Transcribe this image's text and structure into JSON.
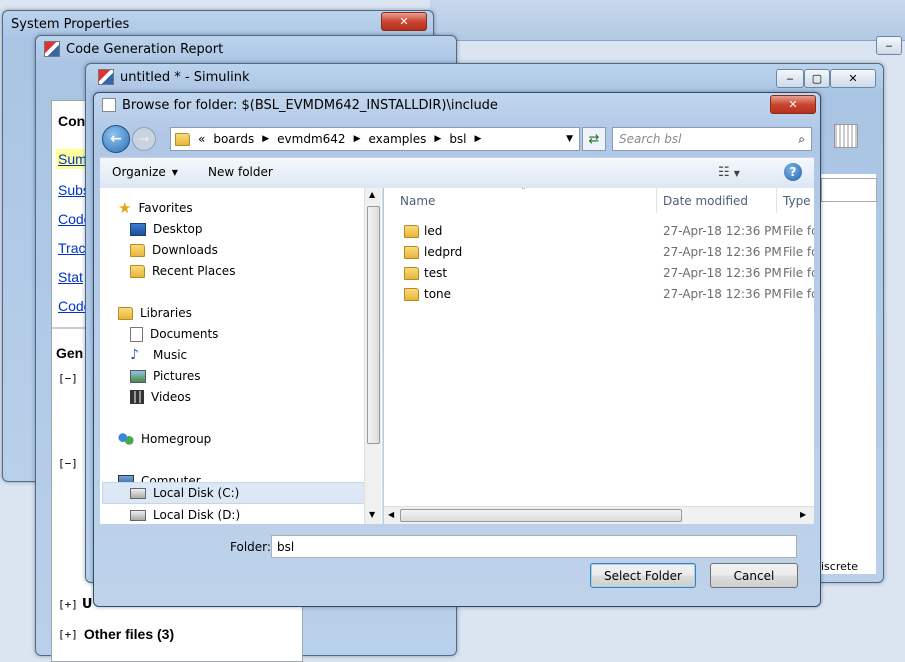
{
  "windows": {
    "system_properties": {
      "title": "System Properties"
    },
    "code_gen_report": {
      "title": "Code Generation Report",
      "contents_heading": "Con",
      "links": [
        "Sum",
        "Subs",
        "Code",
        "Trac",
        "Stat",
        "Code"
      ],
      "gen_heading": "Gen",
      "expanders": [
        "[−]",
        "[−]",
        "[+]",
        "[+]"
      ],
      "bottom_item_partial": "U",
      "other_files": "Other files (3)"
    },
    "simulink": {
      "title": "untitled * - Simulink",
      "status_fragment": "iscrete"
    }
  },
  "dialog": {
    "title": "Browse for folder: $(BSL_EVMDM642_INSTALLDIR)\\include",
    "address": {
      "chevron": "«",
      "crumbs": [
        "boards",
        "evmdm642",
        "examples",
        "bsl"
      ]
    },
    "search_placeholder": "Search bsl",
    "toolbar": {
      "organize": "Organize",
      "new_folder": "New folder"
    },
    "nav": {
      "favorites": "Favorites",
      "favorites_items": [
        "Desktop",
        "Downloads",
        "Recent Places"
      ],
      "libraries": "Libraries",
      "libraries_items": [
        "Documents",
        "Music",
        "Pictures",
        "Videos"
      ],
      "homegroup": "Homegroup",
      "computer": "Computer",
      "computer_items": [
        "Local Disk (C:)",
        "Local Disk (D:)"
      ]
    },
    "columns": {
      "name": "Name",
      "date": "Date modified",
      "type": "Type"
    },
    "files": [
      {
        "name": "led",
        "date": "27-Apr-18 12:36 PM",
        "type": "File fo"
      },
      {
        "name": "ledprd",
        "date": "27-Apr-18 12:36 PM",
        "type": "File fo"
      },
      {
        "name": "test",
        "date": "27-Apr-18 12:36 PM",
        "type": "File fo"
      },
      {
        "name": "tone",
        "date": "27-Apr-18 12:36 PM",
        "type": "File fo"
      }
    ],
    "folder_label": "Folder:",
    "folder_value": "bsl",
    "select_button": "Select Folder",
    "cancel_button": "Cancel"
  },
  "colors": {
    "accent": "#3c7fb1",
    "link": "#0033cc",
    "highlight": "#ffff99",
    "selection": "#dde8f6"
  }
}
